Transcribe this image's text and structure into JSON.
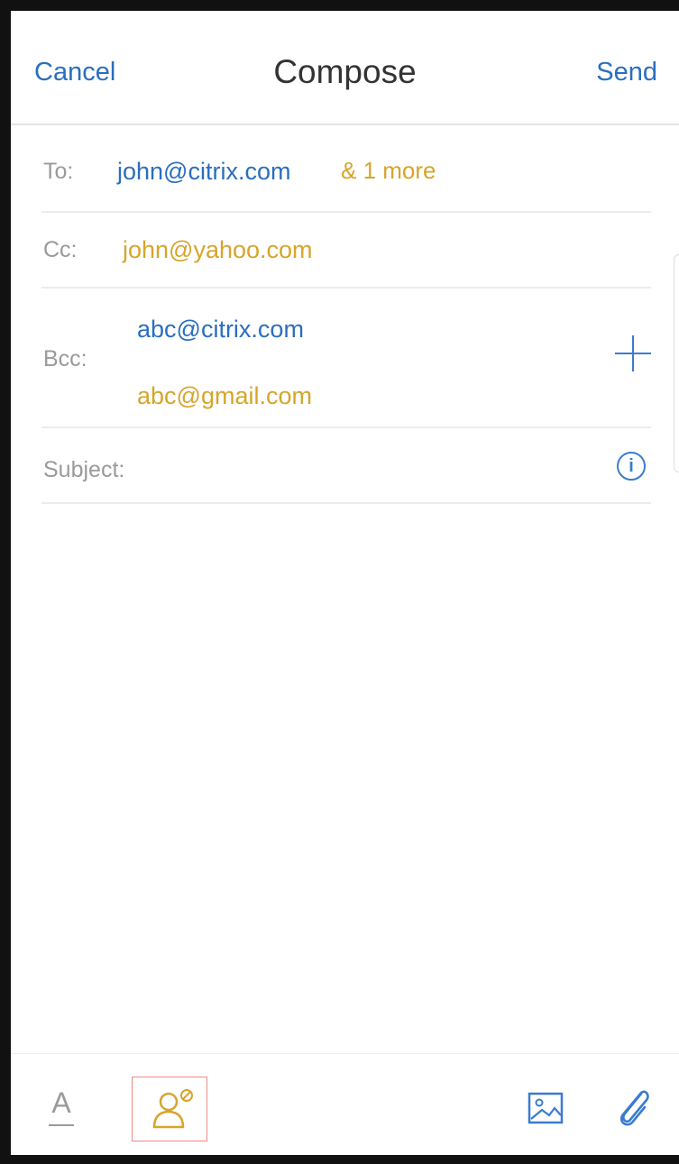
{
  "header": {
    "cancel_label": "Cancel",
    "title": "Compose",
    "send_label": "Send"
  },
  "to": {
    "label": "To:",
    "address": "john@citrix.com",
    "more": "& 1 more"
  },
  "cc": {
    "label": "Cc:",
    "address": "john@yahoo.com"
  },
  "bcc": {
    "label": "Bcc:",
    "addresses": [
      "abc@citrix.com",
      "abc@gmail.com"
    ],
    "add_icon": "plus-icon"
  },
  "subject": {
    "label": "Subject:",
    "value": "",
    "info_icon": "i"
  },
  "toolbar": {
    "font_icon": "A",
    "items": [
      "font-format-icon",
      "contact-blocked-icon",
      "image-icon",
      "paperclip-icon"
    ]
  },
  "colors": {
    "accent_blue": "#2a6ebf",
    "accent_gold": "#d6a52a",
    "label_gray": "#9a9a9a",
    "highlight_red": "#f08a8a"
  }
}
